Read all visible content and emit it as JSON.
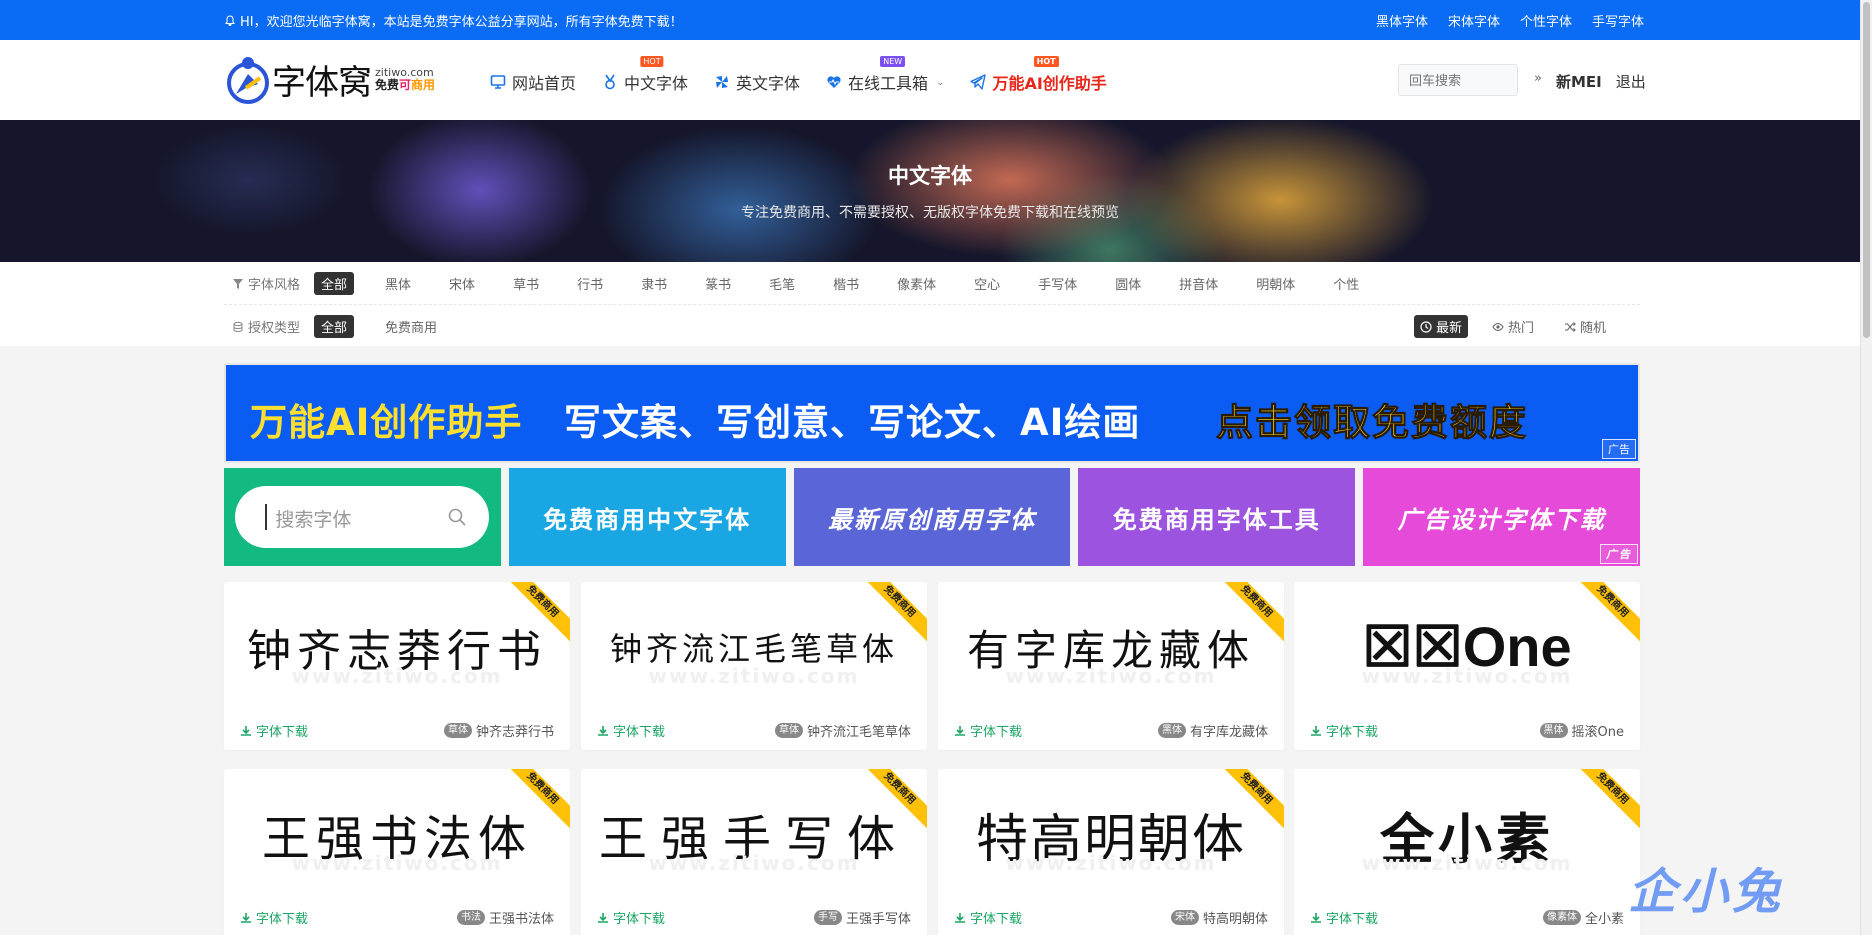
{
  "topbar": {
    "message": "HI，欢迎您光临字体窝，本站是免费字体公益分享网站，所有字体免费下载！",
    "links": [
      "黑体字体",
      "宋体字体",
      "个性字体",
      "手写字体"
    ],
    "bg_color": "#0a6cf5"
  },
  "header": {
    "logo": {
      "name": "字体窝",
      "domain": "zitiwo.com",
      "slogan_a": "免费",
      "slogan_b": "可",
      "slogan_c": "商用"
    },
    "nav": [
      {
        "label": "网站首页",
        "icon": "monitor-icon"
      },
      {
        "label": "中文字体",
        "icon": "medal-icon",
        "badge": "HOT"
      },
      {
        "label": "英文字体",
        "icon": "pinwheel-icon"
      },
      {
        "label": "在线工具箱",
        "icon": "heart-pulse-icon",
        "badge": "NEW"
      },
      {
        "label": "万能AI创作助手",
        "icon": "paper-plane-icon",
        "badge": "HOT"
      }
    ],
    "search_placeholder": "回车搜索",
    "user": {
      "arrow": "»",
      "name": "新MEI",
      "logout": "退出"
    }
  },
  "banner": {
    "title": "中文字体",
    "subtitle": "专注免费商用、不需要授权、无版权字体免费下载和在线预览"
  },
  "filters": {
    "style_label": "字体风格",
    "styles": [
      "全部",
      "黑体",
      "宋体",
      "草书",
      "行书",
      "隶书",
      "篆书",
      "毛笔",
      "楷书",
      "像素体",
      "空心",
      "手写体",
      "圆体",
      "拼音体",
      "明朝体",
      "个性"
    ],
    "license_label": "授权类型",
    "licenses": [
      "全部",
      "免费商用"
    ],
    "sorts": [
      "最新",
      "热门",
      "随机"
    ]
  },
  "ad": {
    "part1": "万能AI创作助手",
    "part2": "写文案、写创意、写论文、AI绘画",
    "part3": "点击领取免费额度",
    "tag": "广告"
  },
  "tiles": {
    "search_placeholder": "搜索字体",
    "items": [
      "免费商用中文字体",
      "最新原创商用字体",
      "免费商用字体工具",
      "广告设计字体下载"
    ],
    "tag": "广告"
  },
  "cards": [
    {
      "preview": "钟齐志莽行书",
      "name": "钟齐志莽行书",
      "cat": "草体",
      "ribbon": "免费商用",
      "download": "字体下载"
    },
    {
      "preview": "钟齐流江毛笔草体",
      "name": "钟齐流江毛笔草体",
      "cat": "草体",
      "ribbon": "免费商用",
      "download": "字体下载"
    },
    {
      "preview": "有字库龙藏体",
      "name": "有字库龙藏体",
      "cat": "黑体",
      "ribbon": "免费商用",
      "download": "字体下载"
    },
    {
      "preview": "☒☒One",
      "name": "摇滚One",
      "cat": "黑体",
      "ribbon": "免费商用",
      "download": "字体下载"
    },
    {
      "preview": "王强书法体",
      "name": "王强书法体",
      "cat": "书法",
      "ribbon": "免费商用",
      "download": "字体下载"
    },
    {
      "preview": "王强手写体",
      "name": "王强手写体",
      "cat": "手写",
      "ribbon": "免费商用",
      "download": "字体下载"
    },
    {
      "preview": "特高明朝体",
      "name": "特高明朝体",
      "cat": "宋体",
      "ribbon": "免费商用",
      "download": "字体下载"
    },
    {
      "preview": "全小素",
      "name": "全小素",
      "cat": "像素体",
      "ribbon": "免费商用",
      "download": "字体下载"
    }
  ],
  "card_watermark": "www.zitiwo.com",
  "corner_watermark": "企小兔"
}
